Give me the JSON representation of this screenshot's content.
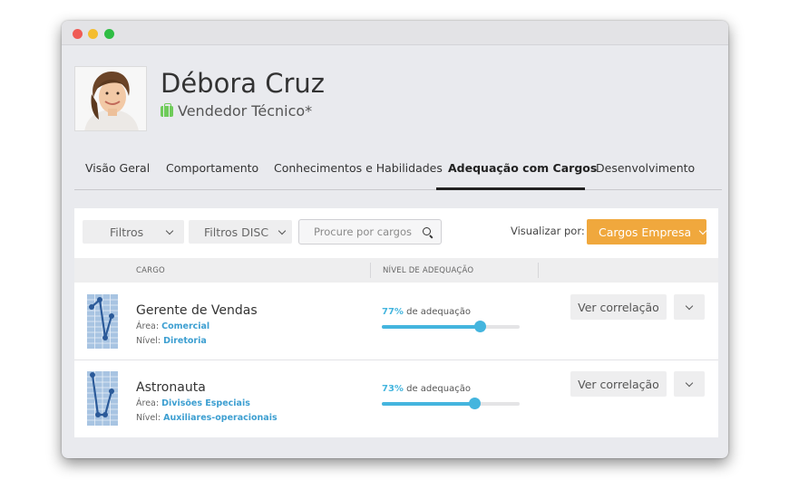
{
  "profile": {
    "name": "Débora Cruz",
    "role": "Vendedor Técnico*"
  },
  "tabs": [
    {
      "label": "Visão Geral"
    },
    {
      "label": "Comportamento"
    },
    {
      "label": "Conhecimentos e Habilidades"
    },
    {
      "label": "Adequação com Cargos",
      "active": true
    },
    {
      "label": "Desenvolvimento"
    }
  ],
  "toolbar": {
    "filters_label": "Filtros",
    "disc_label": "Filtros DISC",
    "search_placeholder": "Procure por cargos",
    "view_by_label": "Visualizar por:",
    "view_by_value": "Cargos Empresa"
  },
  "table": {
    "col_cargo": "CARGO",
    "col_nivel": "NÍVEL DE ADEQUAÇÃO",
    "rows": [
      {
        "title": "Gerente de Vendas",
        "area_label": "Área:",
        "area": "Comercial",
        "level_label": "Nível:",
        "level": "Diretoria",
        "percent": "77%",
        "percent_value": 77,
        "percent_suffix": "de adequação",
        "action": "Ver correlação"
      },
      {
        "title": "Astronauta",
        "area_label": "Área:",
        "area": "Divisões Especiais",
        "level_label": "Nível:",
        "level": "Auxiliares-operacionais",
        "percent": "73%",
        "percent_value": 73,
        "percent_suffix": "de adequação",
        "action": "Ver correlação"
      }
    ]
  },
  "colors": {
    "accent_orange": "#f0a83d",
    "accent_blue": "#44b5de",
    "briefcase_green": "#6fcb5a"
  }
}
